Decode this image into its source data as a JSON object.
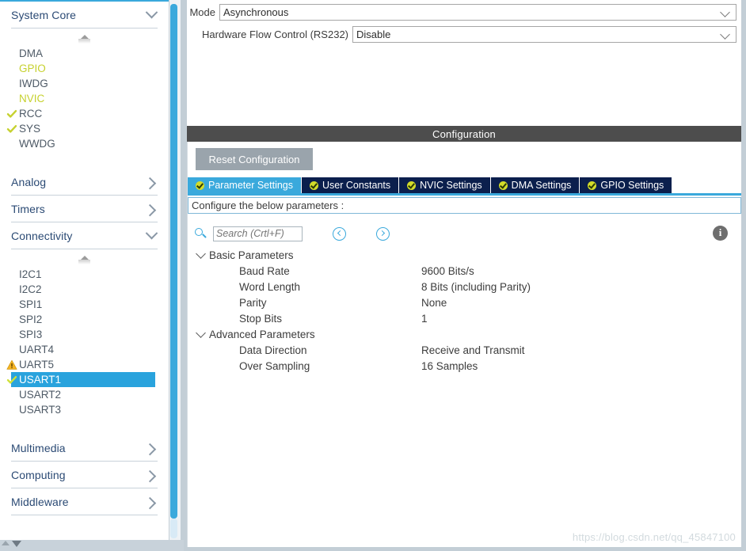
{
  "sidebar": {
    "sections": [
      {
        "label": "System Core",
        "expanded": true,
        "chevron": "chevron-down-icon",
        "items": [
          {
            "label": "DMA",
            "state": "normal"
          },
          {
            "label": "GPIO",
            "state": "configured"
          },
          {
            "label": "IWDG",
            "state": "normal"
          },
          {
            "label": "NVIC",
            "state": "configured"
          },
          {
            "label": "RCC",
            "state": "checked"
          },
          {
            "label": "SYS",
            "state": "checked"
          },
          {
            "label": "WWDG",
            "state": "normal"
          }
        ]
      },
      {
        "label": "Analog",
        "expanded": false,
        "chevron": "chevron-right-icon",
        "items": []
      },
      {
        "label": "Timers",
        "expanded": false,
        "chevron": "chevron-right-icon",
        "items": []
      },
      {
        "label": "Connectivity",
        "expanded": true,
        "chevron": "chevron-down-icon",
        "items": [
          {
            "label": "I2C1",
            "state": "normal"
          },
          {
            "label": "I2C2",
            "state": "normal"
          },
          {
            "label": "SPI1",
            "state": "normal"
          },
          {
            "label": "SPI2",
            "state": "normal"
          },
          {
            "label": "SPI3",
            "state": "normal"
          },
          {
            "label": "UART4",
            "state": "normal"
          },
          {
            "label": "UART5",
            "state": "warning"
          },
          {
            "label": "USART1",
            "state": "selected"
          },
          {
            "label": "USART2",
            "state": "normal"
          },
          {
            "label": "USART3",
            "state": "normal"
          }
        ]
      },
      {
        "label": "Multimedia",
        "expanded": false,
        "chevron": "chevron-right-icon",
        "items": []
      },
      {
        "label": "Computing",
        "expanded": false,
        "chevron": "chevron-right-icon",
        "items": []
      },
      {
        "label": "Middleware",
        "expanded": false,
        "chevron": "chevron-right-icon",
        "items": []
      }
    ]
  },
  "mode_panel": {
    "rows": [
      {
        "label": "Mode",
        "value": "Asynchronous",
        "label_width": 40
      },
      {
        "label": "Hardware Flow Control (RS232)",
        "value": "Disable",
        "label_width": 208
      }
    ]
  },
  "configuration": {
    "title": "Configuration",
    "reset_button": "Reset Configuration",
    "tabs": [
      {
        "label": "Parameter Settings",
        "active": true
      },
      {
        "label": "User Constants",
        "active": false
      },
      {
        "label": "NVIC Settings",
        "active": false
      },
      {
        "label": "DMA Settings",
        "active": false
      },
      {
        "label": "GPIO Settings",
        "active": false
      }
    ],
    "note": "Configure the below parameters :",
    "search_placeholder": "Search (Crtl+F)",
    "search_value": "",
    "tree": [
      {
        "group": "Basic Parameters",
        "expanded": true,
        "params": [
          {
            "name": "Baud Rate",
            "value": "9600 Bits/s"
          },
          {
            "name": "Word Length",
            "value": "8 Bits (including Parity)"
          },
          {
            "name": "Parity",
            "value": "None"
          },
          {
            "name": "Stop Bits",
            "value": "1"
          }
        ]
      },
      {
        "group": "Advanced Parameters",
        "expanded": true,
        "params": [
          {
            "name": "Data Direction",
            "value": "Receive and Transmit"
          },
          {
            "name": "Over Sampling",
            "value": "16 Samples"
          }
        ]
      }
    ]
  },
  "watermark": "https://blog.csdn.net/qq_45847100",
  "colors": {
    "accent_blue": "#3aa9dc",
    "tab_navy": "#0b1f4d",
    "configured_yellow": "#c6d12e",
    "selection_blue": "#29a3dd",
    "config_bar_gray": "#4d4d4d",
    "tab_check_green": "#d2dc2a",
    "warning_amber": "#f5b323"
  }
}
